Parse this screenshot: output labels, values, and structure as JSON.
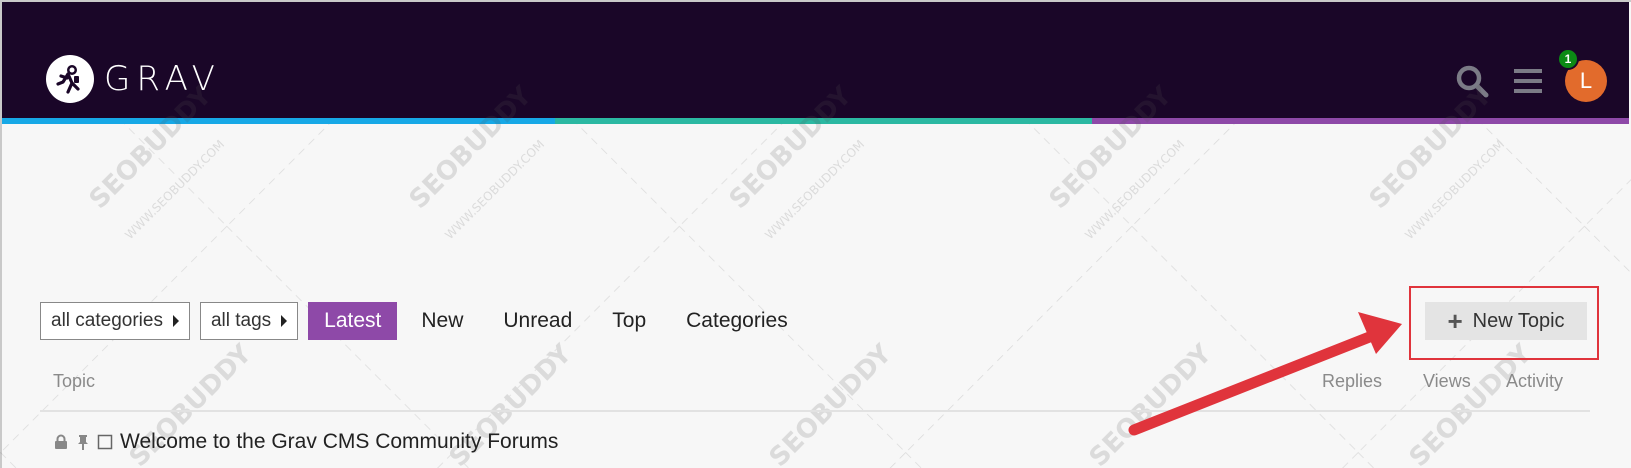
{
  "header": {
    "brand_text": "GRAV",
    "notification_count": "1",
    "avatar_initial": "L",
    "icons": [
      "search-icon",
      "hamburger-menu-icon"
    ]
  },
  "nav": {
    "categories_dropdown": "all categories",
    "tags_dropdown": "all tags",
    "tabs": [
      {
        "label": "Latest",
        "active": true
      },
      {
        "label": "New",
        "active": false
      },
      {
        "label": "Unread",
        "active": false
      },
      {
        "label": "Top",
        "active": false
      },
      {
        "label": "Categories",
        "active": false
      }
    ],
    "new_topic_label": "New Topic"
  },
  "table": {
    "columns": [
      "Topic",
      "Replies",
      "Views",
      "Activity"
    ],
    "rows": [
      {
        "title": "Welcome to the Grav CMS Community Forums",
        "status_icons": [
          "lock-icon",
          "pin-icon",
          "checkbox-icon"
        ]
      }
    ]
  },
  "watermark": {
    "brand": "SEOBUDDY",
    "domain": "WWW.SEOBUDDY.COM"
  },
  "colors": {
    "header_bg": "#1a0628",
    "stripe_blue": "#17a8e6",
    "stripe_teal": "#2bb8a2",
    "stripe_purple": "#8e49a8",
    "active_tab": "#8e49a8",
    "avatar": "#e26b2c",
    "notification": "#0b8a15",
    "annotation_red": "#e0343c"
  }
}
